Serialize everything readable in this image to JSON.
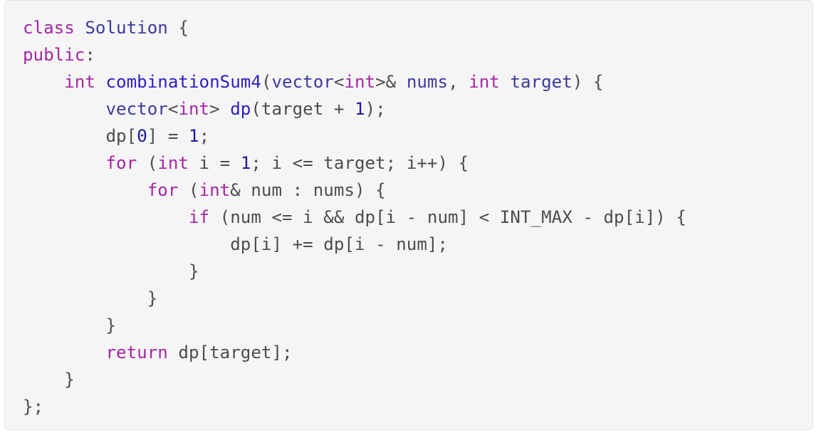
{
  "code": {
    "language": "cpp",
    "colors": {
      "keyword": "#a626a4",
      "type": "#3b3b9e",
      "function": "#2b1fc7",
      "number": "#1a1aa6",
      "plain": "#4d4d4d",
      "background": "#f5f5f5"
    },
    "lines": [
      [
        {
          "t": "kw",
          "v": "class"
        },
        {
          "t": "pl",
          "v": " "
        },
        {
          "t": "ty",
          "v": "Solution"
        },
        {
          "t": "pl",
          "v": " {"
        }
      ],
      [
        {
          "t": "kw",
          "v": "public"
        },
        {
          "t": "pl",
          "v": ":"
        }
      ],
      [
        {
          "t": "pl",
          "v": "    "
        },
        {
          "t": "kw",
          "v": "int"
        },
        {
          "t": "pl",
          "v": " "
        },
        {
          "t": "fn",
          "v": "combinationSum4"
        },
        {
          "t": "pl",
          "v": "("
        },
        {
          "t": "ty",
          "v": "vector"
        },
        {
          "t": "pl",
          "v": "<"
        },
        {
          "t": "kw",
          "v": "int"
        },
        {
          "t": "pl",
          "v": ">& "
        },
        {
          "t": "ty",
          "v": "nums"
        },
        {
          "t": "pl",
          "v": ", "
        },
        {
          "t": "kw",
          "v": "int"
        },
        {
          "t": "pl",
          "v": " "
        },
        {
          "t": "ty",
          "v": "target"
        },
        {
          "t": "pl",
          "v": ") {"
        }
      ],
      [
        {
          "t": "pl",
          "v": "        "
        },
        {
          "t": "ty",
          "v": "vector"
        },
        {
          "t": "pl",
          "v": "<"
        },
        {
          "t": "kw",
          "v": "int"
        },
        {
          "t": "pl",
          "v": "> "
        },
        {
          "t": "fn",
          "v": "dp"
        },
        {
          "t": "pl",
          "v": "(target + "
        },
        {
          "t": "num",
          "v": "1"
        },
        {
          "t": "pl",
          "v": ");"
        }
      ],
      [
        {
          "t": "pl",
          "v": "        dp["
        },
        {
          "t": "num",
          "v": "0"
        },
        {
          "t": "pl",
          "v": "] = "
        },
        {
          "t": "num",
          "v": "1"
        },
        {
          "t": "pl",
          "v": ";"
        }
      ],
      [
        {
          "t": "pl",
          "v": "        "
        },
        {
          "t": "kw",
          "v": "for"
        },
        {
          "t": "pl",
          "v": " ("
        },
        {
          "t": "kw",
          "v": "int"
        },
        {
          "t": "pl",
          "v": " i = "
        },
        {
          "t": "num",
          "v": "1"
        },
        {
          "t": "pl",
          "v": "; i <= target; i++) {"
        }
      ],
      [
        {
          "t": "pl",
          "v": "            "
        },
        {
          "t": "kw",
          "v": "for"
        },
        {
          "t": "pl",
          "v": " ("
        },
        {
          "t": "kw",
          "v": "int"
        },
        {
          "t": "pl",
          "v": "& num : nums) {"
        }
      ],
      [
        {
          "t": "pl",
          "v": "                "
        },
        {
          "t": "kw",
          "v": "if"
        },
        {
          "t": "pl",
          "v": " (num <= i && dp[i - num] < INT_MAX - dp[i]) {"
        }
      ],
      [
        {
          "t": "pl",
          "v": "                    dp[i] += dp[i - num];"
        }
      ],
      [
        {
          "t": "pl",
          "v": "                }"
        }
      ],
      [
        {
          "t": "pl",
          "v": "            }"
        }
      ],
      [
        {
          "t": "pl",
          "v": "        }"
        }
      ],
      [
        {
          "t": "pl",
          "v": "        "
        },
        {
          "t": "kw",
          "v": "return"
        },
        {
          "t": "pl",
          "v": " dp[target];"
        }
      ],
      [
        {
          "t": "pl",
          "v": "    }"
        }
      ],
      [
        {
          "t": "pl",
          "v": "};"
        }
      ]
    ]
  }
}
